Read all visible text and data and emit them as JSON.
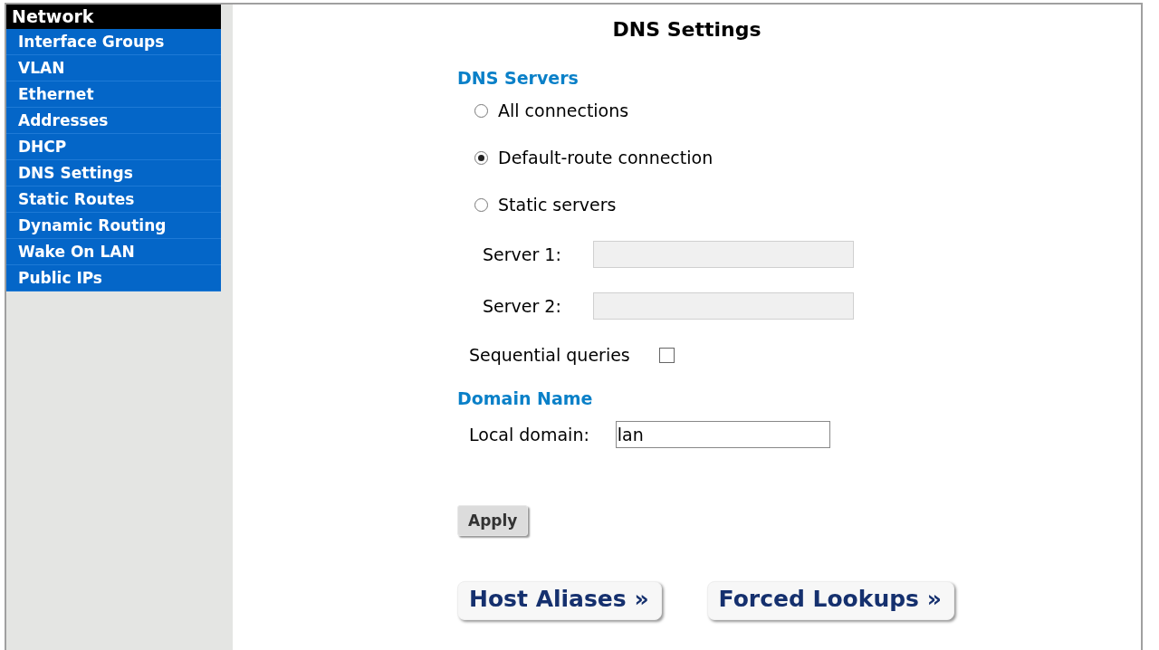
{
  "sidebar": {
    "heading": "Network",
    "items": [
      {
        "label": "Interface Groups"
      },
      {
        "label": "VLAN"
      },
      {
        "label": "Ethernet"
      },
      {
        "label": "Addresses"
      },
      {
        "label": "DHCP"
      },
      {
        "label": "DNS Settings"
      },
      {
        "label": "Static Routes"
      },
      {
        "label": "Dynamic Routing"
      },
      {
        "label": "Wake On LAN"
      },
      {
        "label": "Public IPs"
      }
    ]
  },
  "page": {
    "title": "DNS Settings"
  },
  "dns_servers": {
    "heading": "DNS Servers",
    "options": [
      {
        "label": "All connections",
        "selected": false
      },
      {
        "label": "Default-route connection",
        "selected": true
      },
      {
        "label": "Static servers",
        "selected": false
      }
    ],
    "servers": [
      {
        "label": "Server 1:",
        "disabled": true
      },
      {
        "label": "Server 2:",
        "disabled": true
      }
    ],
    "sequential_queries": {
      "label": "Sequential queries",
      "checked": false
    }
  },
  "domain_name": {
    "heading": "Domain Name",
    "local_domain": {
      "label": "Local domain:",
      "value": "lan"
    }
  },
  "apply_button": "Apply",
  "links": [
    "Host Aliases »",
    "Forced Lookups »"
  ]
}
